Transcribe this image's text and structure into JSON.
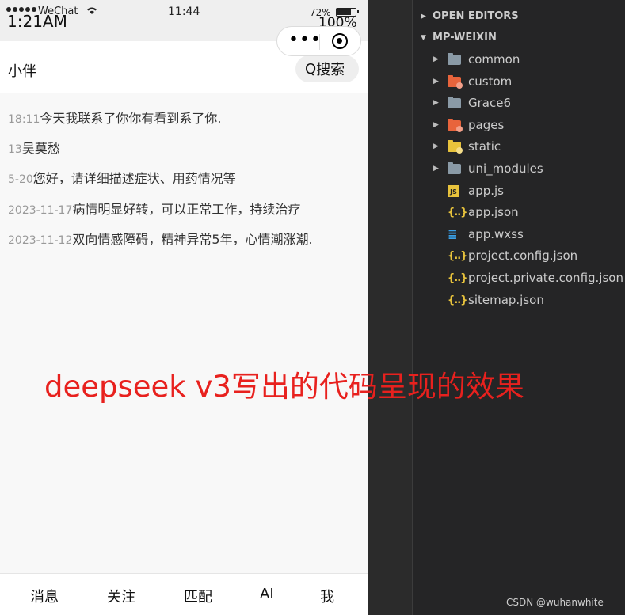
{
  "statusbar": {
    "carrier": "WeChat",
    "clock": "11:44",
    "battery_percent": "72%",
    "overlay_time": "1:21AM",
    "overlay_percent": "100%"
  },
  "navbar": {
    "title": "小伴",
    "search_icon_text": "Q",
    "search_label": "搜索"
  },
  "messages": [
    {
      "time": "18:11",
      "text": "今天我联系了你你有看到系了你."
    },
    {
      "time": "13",
      "text": "吴莫愁"
    },
    {
      "time": "5-20",
      "text": "您好，请详细描述症状、用药情况等"
    },
    {
      "time": "2023-11-17",
      "text": "病情明显好转，可以正常工作，持续治疗"
    },
    {
      "time": "2023-11-12",
      "text": "双向情感障碍，精神异常5年，心情潮涨潮."
    }
  ],
  "tabbar": [
    "消息",
    "关注",
    "匹配",
    "AI",
    "我"
  ],
  "explorer": {
    "open_editors": "OPEN EDITORS",
    "project": "MP-WEIXIN",
    "items": [
      {
        "name": "common",
        "kind": "folder",
        "icon": "folder-icon",
        "color": "#8a9aa6"
      },
      {
        "name": "custom",
        "kind": "folder",
        "icon": "folder-custom-icon",
        "color": "#e8643c"
      },
      {
        "name": "Grace6",
        "kind": "folder",
        "icon": "folder-icon",
        "color": "#8a9aa6"
      },
      {
        "name": "pages",
        "kind": "folder",
        "icon": "folder-pages-icon",
        "color": "#e8643c"
      },
      {
        "name": "static",
        "kind": "folder",
        "icon": "folder-static-icon",
        "color": "#e8c33c"
      },
      {
        "name": "uni_modules",
        "kind": "folder",
        "icon": "folder-icon",
        "color": "#8a9aa6"
      },
      {
        "name": "app.js",
        "kind": "file",
        "icon": "js-file-icon",
        "color": "#e8c33c"
      },
      {
        "name": "app.json",
        "kind": "file",
        "icon": "json-file-icon",
        "color": "#e8c33c"
      },
      {
        "name": "app.wxss",
        "kind": "file",
        "icon": "css-file-icon",
        "color": "#3aa0e6"
      },
      {
        "name": "project.config.json",
        "kind": "file",
        "icon": "json-file-icon",
        "color": "#e8c33c"
      },
      {
        "name": "project.private.config.json",
        "kind": "file",
        "icon": "json-file-icon",
        "color": "#e8c33c"
      },
      {
        "name": "sitemap.json",
        "kind": "file",
        "icon": "json-file-icon",
        "color": "#e8c33c"
      }
    ]
  },
  "caption": "deepseek v3写出的代码呈现的效果",
  "watermark": "CSDN @wuhanwhite",
  "colors": {
    "caption": "#e8211e",
    "explorer_bg": "#252526",
    "phone_bg": "#f8f8f8"
  }
}
